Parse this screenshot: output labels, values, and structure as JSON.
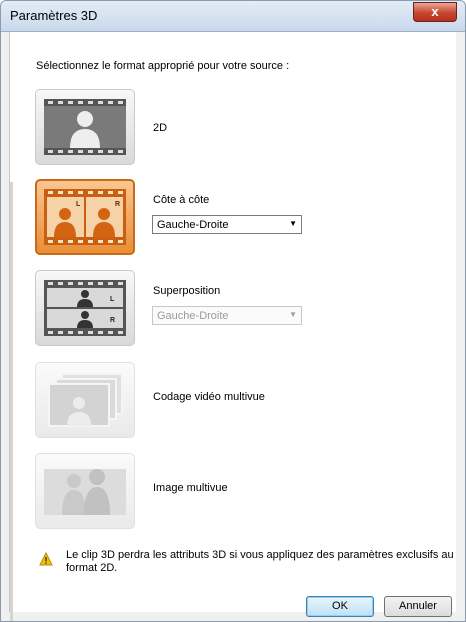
{
  "window": {
    "title": "Paramètres 3D",
    "close_glyph": "x"
  },
  "instruction": "Sélectionnez le format approprié pour votre source :",
  "options": [
    {
      "id": "2d",
      "label": "2D",
      "icon": "2d-film-icon",
      "selected": false
    },
    {
      "id": "side-by-side",
      "label": "Côte à côte",
      "icon": "side-by-side-film-icon",
      "selected": true,
      "dropdown": {
        "value": "Gauche-Droite",
        "enabled": true
      }
    },
    {
      "id": "over-under",
      "label": "Superposition",
      "icon": "over-under-film-icon",
      "selected": false,
      "dropdown": {
        "value": "Gauche-Droite",
        "enabled": false
      }
    },
    {
      "id": "mvc",
      "label": "Codage vidéo multivue",
      "icon": "multiview-video-icon",
      "selected": false,
      "disabled": true
    },
    {
      "id": "mpo",
      "label": "Image multivue",
      "icon": "multiview-image-icon",
      "selected": false,
      "disabled": true
    }
  ],
  "warning": {
    "icon": "warning-icon",
    "text": "Le clip 3D perdra les attributs 3D si vous appliquez des paramètres exclusifs au format 2D."
  },
  "buttons": {
    "ok": "OK",
    "cancel": "Annuler"
  },
  "colors": {
    "selected_fill": "#ef9a43",
    "selected_border": "#c86a1c",
    "title_bar": "#d3e1f0",
    "close_button": "#c7462f"
  }
}
